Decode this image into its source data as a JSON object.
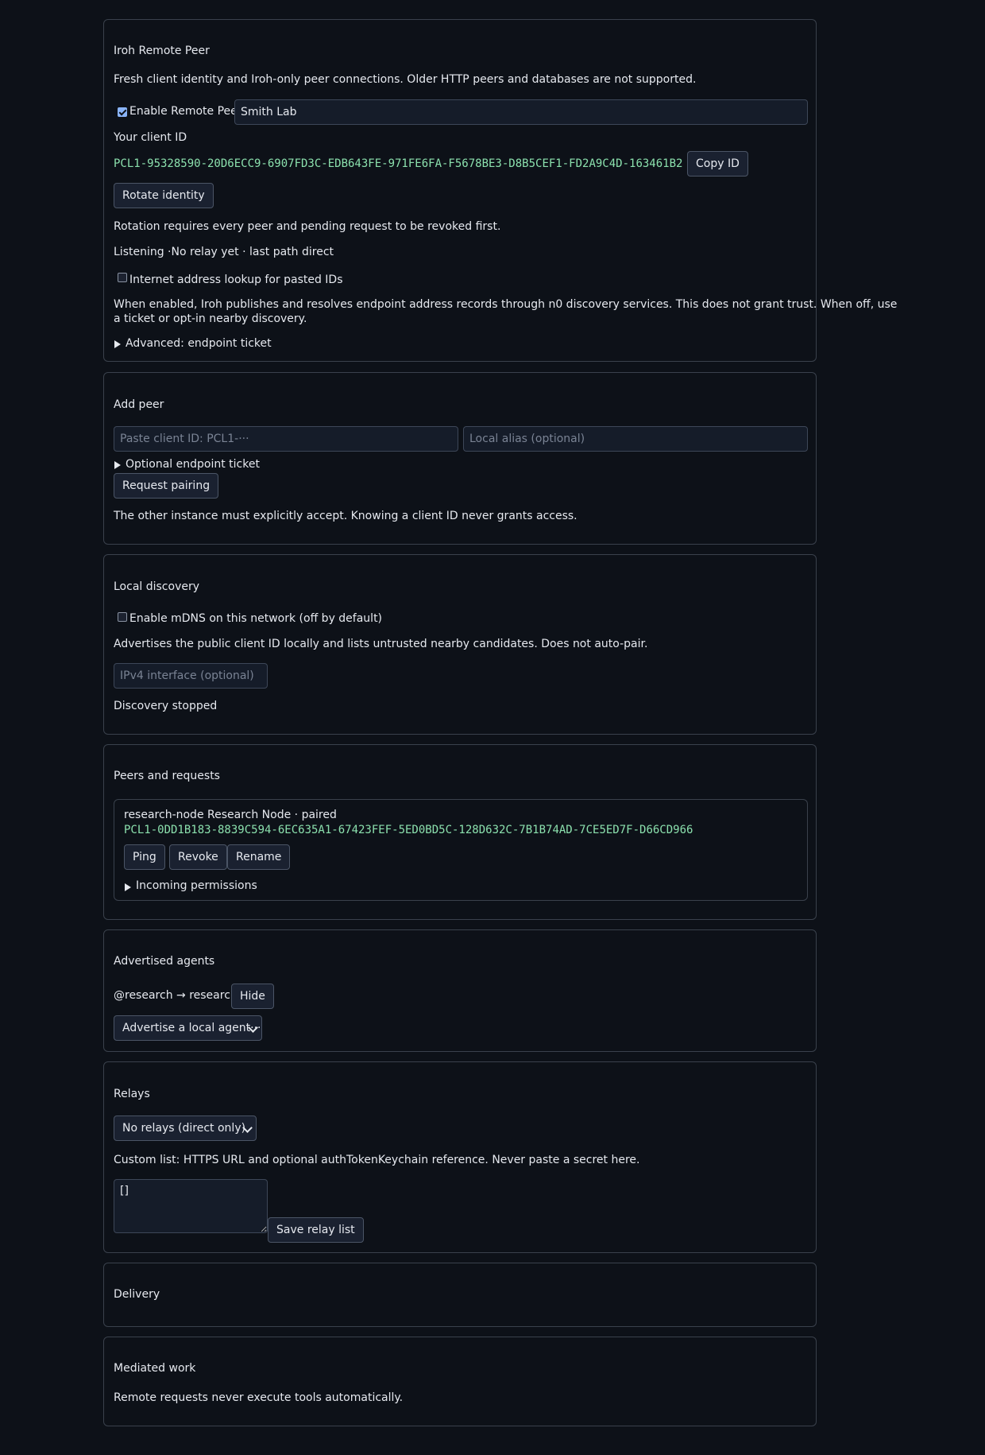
{
  "colors": {
    "background": "#0d1118",
    "card_border": "#3a414c",
    "mono_green": "#8be0ad",
    "checkbox_accent": "#8ab4f8"
  },
  "remote_peer": {
    "title": "Iroh Remote Peer",
    "description": "Fresh client identity and Iroh-only peer connections. Older HTTP peers and databases are not supported.",
    "enable_label": "Enable Remote Peer",
    "enable_checked": true,
    "name_value": "Smith Lab",
    "client_id_label": "Your client ID",
    "client_id": "PCL1-95328590-20D6ECC9-6907FD3C-EDB643FE-971FE6FA-F5678BE3-D8B5CEF1-FD2A9C4D-163461B2",
    "copy_button": "Copy ID",
    "rotate_button": "Rotate identity",
    "rotation_note": "Rotation requires every peer and pending request to be revoked first.",
    "status": "Listening ·No relay yet · last path direct",
    "lookup_label": "Internet address lookup for pasted IDs",
    "lookup_checked": false,
    "lookup_note_line1": "When enabled, Iroh publishes and resolves endpoint address records through n0 discovery services. This does not grant trust. When off, use",
    "lookup_note_line2": "a ticket or opt-in nearby discovery.",
    "advanced_summary": "Advanced: endpoint ticket"
  },
  "add_peer": {
    "title": "Add peer",
    "client_id_placeholder": "Paste client ID: PCL1-···",
    "alias_placeholder": "Local alias (optional)",
    "ticket_summary": "Optional endpoint ticket",
    "request_button": "Request pairing",
    "note": "The other instance must explicitly accept. Knowing a client ID never grants access."
  },
  "local_discovery": {
    "title": "Local discovery",
    "mdns_label": "Enable mDNS on this network (off by default)",
    "mdns_checked": false,
    "note": "Advertises the public client ID locally and lists untrusted nearby candidates. Does not auto-pair.",
    "interface_placeholder": "IPv4 interface (optional)",
    "status": "Discovery stopped"
  },
  "peers": {
    "title": "Peers and requests",
    "items": [
      {
        "heading": "research-node Research Node · paired",
        "id": "PCL1-0DD1B183-8839C594-6EC635A1-67423FEF-5ED0BD5C-128D632C-7B1B74AD-7CE5ED7F-D66CD966",
        "ping": "Ping",
        "revoke": "Revoke",
        "rename": "Rename",
        "permissions_summary": "Incoming permissions"
      }
    ]
  },
  "agents": {
    "title": "Advertised agents",
    "entry": "@research → research",
    "hide_button": "Hide",
    "advertise_select": "Advertise a local agent···"
  },
  "relays": {
    "title": "Relays",
    "select_value": "No relays (direct only)",
    "note": "Custom list: HTTPS URL and optional authTokenKeychain reference. Never paste a secret here.",
    "textarea_value": "[]",
    "save_button": "Save relay list"
  },
  "delivery": {
    "title": "Delivery"
  },
  "mediated": {
    "title": "Mediated work",
    "note": "Remote requests never execute tools automatically."
  }
}
